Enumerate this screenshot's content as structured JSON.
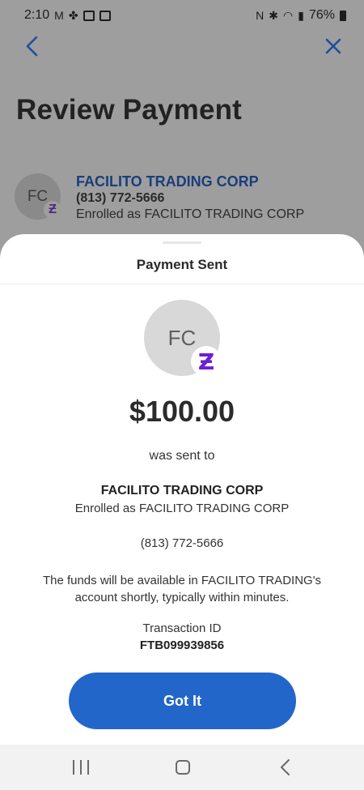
{
  "status_bar": {
    "time": "2:10",
    "battery": "76%"
  },
  "background": {
    "title": "Review Payment",
    "recipient": {
      "initials": "FC",
      "name": "FACILITO TRADING CORP",
      "phone": "(813) 772-5666",
      "enrolled": "Enrolled as FACILITO TRADING CORP"
    }
  },
  "sheet": {
    "title": "Payment Sent",
    "avatar_initials": "FC",
    "badge_glyph": "Ƶ",
    "amount": "$100.00",
    "sent_to_text": "was sent to",
    "recipient_name": "FACILITO TRADING CORP",
    "recipient_enrolled": "Enrolled as FACILITO TRADING CORP",
    "recipient_phone": "(813) 772-5666",
    "funds_note": "The funds will be available in FACILITO TRADING's account shortly, typically within minutes.",
    "transaction_label": "Transaction ID",
    "transaction_id": "FTB099939856",
    "got_it_label": "Got It"
  },
  "colors": {
    "accent": "#2266c9",
    "zelle_purple": "#6d1ed4",
    "name_blue": "#1a3e7c"
  }
}
